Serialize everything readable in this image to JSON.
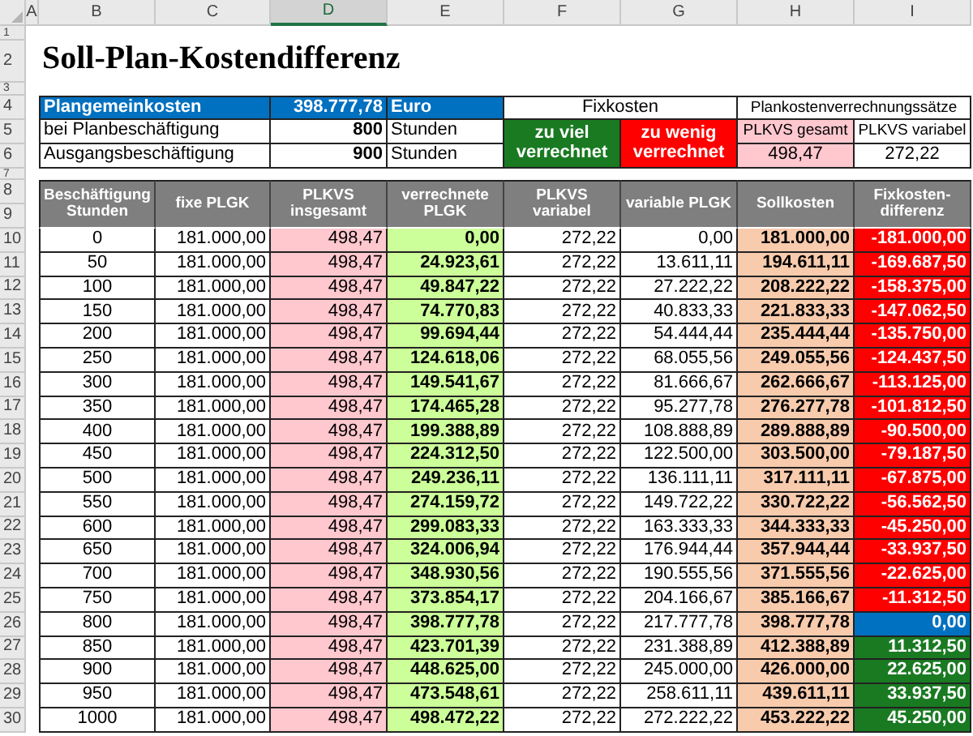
{
  "columns": [
    {
      "label": "A",
      "selected": false
    },
    {
      "label": "B",
      "selected": false
    },
    {
      "label": "C",
      "selected": false
    },
    {
      "label": "D",
      "selected": true
    },
    {
      "label": "E",
      "selected": false
    },
    {
      "label": "F",
      "selected": false
    },
    {
      "label": "G",
      "selected": false
    },
    {
      "label": "H",
      "selected": false
    },
    {
      "label": "I",
      "selected": false
    }
  ],
  "row_numbers": [
    "1",
    "2",
    "3",
    "4",
    "5",
    "6",
    "7",
    "8",
    "9",
    "10",
    "11",
    "12",
    "13",
    "14",
    "15",
    "16",
    "17",
    "18",
    "19",
    "20",
    "21",
    "22",
    "23",
    "24",
    "25",
    "26",
    "27",
    "28",
    "29",
    "30"
  ],
  "title": "Soll-Plan-Kostendifferenz",
  "parameters": [
    {
      "label": "Plangemeinkosten",
      "value": "398.777,78",
      "unit": "Euro",
      "highlighted": true
    },
    {
      "label": "bei Planbeschäftigung",
      "value": "800",
      "unit": "Stunden",
      "highlighted": false
    },
    {
      "label": "Ausgangsbeschäftigung",
      "value": "900",
      "unit": "Stunden",
      "highlighted": false
    }
  ],
  "fixkosten_legend": {
    "title": "Fixkosten",
    "items": [
      {
        "label": "zu viel verrechnet",
        "color": "#1a7a22"
      },
      {
        "label": "zu wenig verrechnet",
        "color": "#ff0000"
      }
    ]
  },
  "rates": {
    "title": "Plankostenverrechnungssätze",
    "items": [
      {
        "label": "PLKVS gesamt",
        "value": "498,47",
        "highlighted": true
      },
      {
        "label": "PLKVS variabel",
        "value": "272,22",
        "highlighted": false
      }
    ]
  },
  "table": {
    "columns": [
      "Beschäftigung Stunden",
      "fixe PLGK",
      "PLKVS insgesamt",
      "verrechnete PLGK",
      "PLKVS variabel",
      "variable PLGK",
      "Sollkosten",
      "Fixkosten-differenz"
    ],
    "rows": [
      {
        "cells": [
          "0",
          "181.000,00",
          "498,47",
          "0,00",
          "272,22",
          "0,00",
          "181.000,00",
          "-181.000,00"
        ],
        "color": "#ff0000"
      },
      {
        "cells": [
          "50",
          "181.000,00",
          "498,47",
          "24.923,61",
          "272,22",
          "13.611,11",
          "194.611,11",
          "-169.687,50"
        ],
        "color": "#ff0000"
      },
      {
        "cells": [
          "100",
          "181.000,00",
          "498,47",
          "49.847,22",
          "272,22",
          "27.222,22",
          "208.222,22",
          "-158.375,00"
        ],
        "color": "#ff0000"
      },
      {
        "cells": [
          "150",
          "181.000,00",
          "498,47",
          "74.770,83",
          "272,22",
          "40.833,33",
          "221.833,33",
          "-147.062,50"
        ],
        "color": "#ff0000"
      },
      {
        "cells": [
          "200",
          "181.000,00",
          "498,47",
          "99.694,44",
          "272,22",
          "54.444,44",
          "235.444,44",
          "-135.750,00"
        ],
        "color": "#ff0000"
      },
      {
        "cells": [
          "250",
          "181.000,00",
          "498,47",
          "124.618,06",
          "272,22",
          "68.055,56",
          "249.055,56",
          "-124.437,50"
        ],
        "color": "#ff0000"
      },
      {
        "cells": [
          "300",
          "181.000,00",
          "498,47",
          "149.541,67",
          "272,22",
          "81.666,67",
          "262.666,67",
          "-113.125,00"
        ],
        "color": "#ff0000"
      },
      {
        "cells": [
          "350",
          "181.000,00",
          "498,47",
          "174.465,28",
          "272,22",
          "95.277,78",
          "276.277,78",
          "-101.812,50"
        ],
        "color": "#ff0000"
      },
      {
        "cells": [
          "400",
          "181.000,00",
          "498,47",
          "199.388,89",
          "272,22",
          "108.888,89",
          "289.888,89",
          "-90.500,00"
        ],
        "color": "#ff0000"
      },
      {
        "cells": [
          "450",
          "181.000,00",
          "498,47",
          "224.312,50",
          "272,22",
          "122.500,00",
          "303.500,00",
          "-79.187,50"
        ],
        "color": "#ff0000"
      },
      {
        "cells": [
          "500",
          "181.000,00",
          "498,47",
          "249.236,11",
          "272,22",
          "136.111,11",
          "317.111,11",
          "-67.875,00"
        ],
        "color": "#ff0000"
      },
      {
        "cells": [
          "550",
          "181.000,00",
          "498,47",
          "274.159,72",
          "272,22",
          "149.722,22",
          "330.722,22",
          "-56.562,50"
        ],
        "color": "#ff0000"
      },
      {
        "cells": [
          "600",
          "181.000,00",
          "498,47",
          "299.083,33",
          "272,22",
          "163.333,33",
          "344.333,33",
          "-45.250,00"
        ],
        "color": "#ff0000"
      },
      {
        "cells": [
          "650",
          "181.000,00",
          "498,47",
          "324.006,94",
          "272,22",
          "176.944,44",
          "357.944,44",
          "-33.937,50"
        ],
        "color": "#ff0000"
      },
      {
        "cells": [
          "700",
          "181.000,00",
          "498,47",
          "348.930,56",
          "272,22",
          "190.555,56",
          "371.555,56",
          "-22.625,00"
        ],
        "color": "#ff0000"
      },
      {
        "cells": [
          "750",
          "181.000,00",
          "498,47",
          "373.854,17",
          "272,22",
          "204.166,67",
          "385.166,67",
          "-11.312,50"
        ],
        "color": "#ff0000"
      },
      {
        "cells": [
          "800",
          "181.000,00",
          "498,47",
          "398.777,78",
          "272,22",
          "217.777,78",
          "398.777,78",
          "0,00"
        ],
        "color": "#0070c0"
      },
      {
        "cells": [
          "850",
          "181.000,00",
          "498,47",
          "423.701,39",
          "272,22",
          "231.388,89",
          "412.388,89",
          "11.312,50"
        ],
        "color": "#1a7a22"
      },
      {
        "cells": [
          "900",
          "181.000,00",
          "498,47",
          "448.625,00",
          "272,22",
          "245.000,00",
          "426.000,00",
          "22.625,00"
        ],
        "color": "#1a7a22"
      },
      {
        "cells": [
          "950",
          "181.000,00",
          "498,47",
          "473.548,61",
          "272,22",
          "258.611,11",
          "439.611,11",
          "33.937,50"
        ],
        "color": "#1a7a22"
      },
      {
        "cells": [
          "1000",
          "181.000,00",
          "498,47",
          "498.472,22",
          "272,22",
          "272.222,22",
          "453.222,22",
          "45.250,00"
        ],
        "color": "#1a7a22"
      }
    ]
  }
}
